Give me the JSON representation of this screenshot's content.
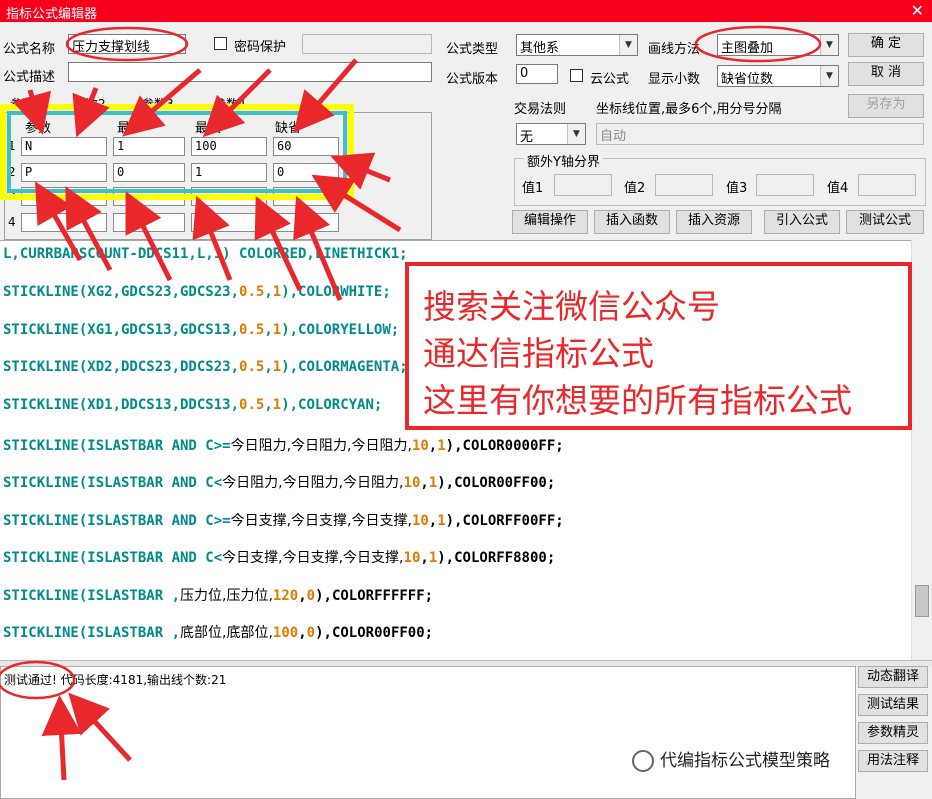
{
  "window": {
    "title": "指标公式编辑器",
    "close_glyph": "✕"
  },
  "form": {
    "name_label": "公式名称",
    "name_value": "压力支撑划线",
    "password_label": "密码保护",
    "desc_label": "公式描述",
    "type_label": "公式类型",
    "type_value": "其他系",
    "draw_label": "画线方法",
    "draw_value": "主图叠加",
    "version_label": "公式版本",
    "version_value": "0",
    "cloud_label": "云公式",
    "decimals_label": "显示小数",
    "decimals_value": "缺省位数",
    "trade_label": "交易法则",
    "trade_value": "无",
    "axis_label": "坐标线位置,最多6个,用分号分隔",
    "axis_value": "自动",
    "extra_y_label": "额外Y轴分界",
    "val1": "值1",
    "val2": "值2",
    "val3": "值3",
    "val4": "值4"
  },
  "buttons": {
    "ok": "确  定",
    "cancel": "取  消",
    "save_as": "另存为",
    "edit_ops": "编辑操作",
    "insert_fn": "插入函数",
    "insert_res": "插入资源",
    "import": "引入公式",
    "test": "测试公式"
  },
  "tabs": [
    "参数1",
    "参数2",
    "参数3",
    "参数4"
  ],
  "params": {
    "headers": [
      "参数",
      "最小",
      "最大",
      "缺省"
    ],
    "rows": [
      {
        "no": "1",
        "name": "N",
        "min": "1",
        "max": "100",
        "def": "60"
      },
      {
        "no": "2",
        "name": "P",
        "min": "0",
        "max": "1",
        "def": "0"
      },
      {
        "no": "3",
        "name": "",
        "min": "",
        "max": "",
        "def": ""
      },
      {
        "no": "4",
        "name": "",
        "min": "",
        "max": "",
        "def": ""
      }
    ]
  },
  "code": {
    "line0": "L,CURRBARSCOUNT-DDCS11,L,1) COLORRED,LINETHICK1;",
    "lines": [
      {
        "a": "STICKLINE(XG2,GDCS23,GDCS23,",
        "n1": "0.5",
        "c": ",",
        "n2": "1",
        "d": "),COLORWHITE;"
      },
      {
        "a": "STICKLINE(XG1,GDCS13,GDCS13,",
        "n1": "0.5",
        "c": ",",
        "n2": "1",
        "d": "),COLORYELLOW;"
      },
      {
        "a": "STICKLINE(XD2,DDCS23,DDCS23,",
        "n1": "0.5",
        "c": ",",
        "n2": "1",
        "d": "),COLORMAGENTA;"
      },
      {
        "a": "STICKLINE(XD1,DDCS13,DDCS13,",
        "n1": "0.5",
        "c": ",",
        "n2": "1",
        "d": "),COLORCYAN;"
      }
    ],
    "cn_lines": [
      {
        "a": "STICKLINE(ISLASTBAR AND C>=",
        "b": "今日阻力,今日阻力,今日阻力,",
        "n1": "10",
        "n2": "1",
        "d": "),COLOR0000FF;"
      },
      {
        "a": "STICKLINE(ISLASTBAR AND C<",
        "b": "今日阻力,今日阻力,今日阻力,",
        "n1": "10",
        "n2": "1",
        "d": "),COLOR00FF00;"
      },
      {
        "a": "STICKLINE(ISLASTBAR AND C>=",
        "b": "今日支撑,今日支撑,今日支撑,",
        "n1": "10",
        "n2": "1",
        "d": "),COLORFF00FF;"
      },
      {
        "a": "STICKLINE(ISLASTBAR AND C<",
        "b": "今日支撑,今日支撑,今日支撑,",
        "n1": "10",
        "n2": "1",
        "d": "),COLORFF8800;"
      },
      {
        "a": "STICKLINE(ISLASTBAR ,",
        "b": "压力位,压力位,",
        "n1": "120",
        "n2": "0",
        "d": "),COLORFFFFFF;"
      },
      {
        "a": "STICKLINE(ISLASTBAR ,",
        "b": "底部位,底部位,",
        "n1": "100",
        "n2": "0",
        "d": "),COLOR00FF00;"
      }
    ]
  },
  "output": {
    "text": "测试通过! 代码长度:4181,输出线个数:21"
  },
  "side_buttons": [
    "动态翻译",
    "测试结果",
    "参数精灵",
    "用法注释"
  ],
  "overlay": {
    "line1": "搜索关注微信公众号",
    "line2": "通达信指标公式",
    "line3": "这里有你想要的所有指标公式"
  },
  "watermark": "代编指标公式模型策略",
  "colors": {
    "title_bar": "#f6001c",
    "annotation": "#e8282b",
    "highlight_yellow": "#ffff00",
    "highlight_teal": "#3cc0c0"
  }
}
